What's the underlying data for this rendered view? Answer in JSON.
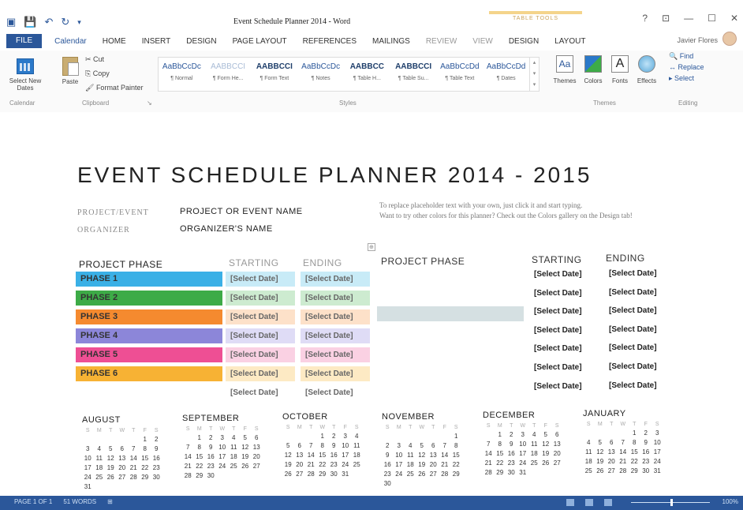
{
  "window": {
    "title": "Event Schedule Planner 2014 - Word",
    "context_tab_group": "TABLE TOOLS",
    "controls": [
      "?",
      "⊡",
      "—",
      "☐",
      "✕"
    ],
    "user": "Javier Flores"
  },
  "tabs": [
    "FILE",
    "Calendar",
    "HOME",
    "INSERT",
    "DESIGN",
    "PAGE LAYOUT",
    "REFERENCES",
    "MAILINGS",
    "REVIEW",
    "VIEW",
    "DESIGN",
    "LAYOUT"
  ],
  "ribbon": {
    "calendar_group": {
      "button": "Select New Dates",
      "label": "Calendar"
    },
    "clipboard_group": {
      "paste": "Paste",
      "cut": "Cut",
      "copy": "Copy",
      "format_painter": "Format Painter",
      "label": "Clipboard"
    },
    "styles": [
      {
        "sample": "AaBbCcDc",
        "name": "¶ Normal"
      },
      {
        "sample": "AABBCCI",
        "name": "¶ Form He..."
      },
      {
        "sample": "AABBCCI",
        "name": "¶ Form Text"
      },
      {
        "sample": "AaBbCcDc",
        "name": "¶ Notes"
      },
      {
        "sample": "AABBCC",
        "name": "¶ Table H..."
      },
      {
        "sample": "AABBCCI",
        "name": "¶ Table Su..."
      },
      {
        "sample": "AaBbCcDd",
        "name": "¶ Table Text"
      },
      {
        "sample": "AaBbCcDd",
        "name": "¶ Dates"
      }
    ],
    "styles_label": "Styles",
    "themes": [
      "Themes",
      "Colors",
      "Fonts",
      "Effects"
    ],
    "themes_label": "Themes",
    "editing": [
      "Find",
      "Replace",
      "Select"
    ],
    "editing_label": "Editing"
  },
  "document": {
    "title": "EVENT SCHEDULE PLANNER 2014 - 2015",
    "project_label": "PROJECT/EVENT",
    "project_value": "PROJECT OR EVENT NAME",
    "organizer_label": "ORGANIZER",
    "organizer_value": "ORGANIZER'S NAME",
    "tip_line1": "To replace placeholder text with your own, just click it and start typing.",
    "tip_line2": "Want to try other colors for this planner? Check out the Colors gallery on the Design tab!",
    "headers": {
      "phase": "PROJECT PHASE",
      "starting": "STARTING",
      "ending": "ENDING"
    },
    "phases": [
      {
        "name": "PHASE 1",
        "color": "#3ab0e6",
        "start": "[Select Date]",
        "end": "[Select Date]",
        "light": "#c8ebf7"
      },
      {
        "name": "PHASE 2",
        "color": "#3dab47",
        "start": "[Select Date]",
        "end": "[Select Date]",
        "light": "#cdebd0"
      },
      {
        "name": "PHASE 3",
        "color": "#f58a2f",
        "start": "[Select Date]",
        "end": "[Select Date]",
        "light": "#fde1c9"
      },
      {
        "name": "PHASE 4",
        "color": "#8c86d9",
        "start": "[Select Date]",
        "end": "[Select Date]",
        "light": "#dfdcf6"
      },
      {
        "name": "PHASE 5",
        "color": "#ee4f94",
        "start": "[Select Date]",
        "end": "[Select Date]",
        "light": "#fad1e3"
      },
      {
        "name": "PHASE 6",
        "color": "#f7b234",
        "start": "[Select Date]",
        "end": "[Select Date]",
        "light": "#fdeac4"
      }
    ],
    "extra_row": {
      "start": "[Select Date]",
      "end": "[Select Date]"
    },
    "right_dates": [
      {
        "start": "[Select Date]",
        "end": "[Select Date]"
      },
      {
        "start": "[Select Date]",
        "end": "[Select Date]"
      },
      {
        "start": "[Select Date]",
        "end": "[Select Date]"
      },
      {
        "start": "[Select Date]",
        "end": "[Select Date]"
      },
      {
        "start": "[Select Date]",
        "end": "[Select Date]"
      },
      {
        "start": "[Select Date]",
        "end": "[Select Date]"
      },
      {
        "start": "[Select Date]",
        "end": "[Select Date]"
      }
    ]
  },
  "calendars": [
    {
      "name": "AUGUST",
      "weeks": [
        [
          "",
          "",
          "",
          "",
          "",
          "1",
          "2"
        ],
        [
          "3",
          "4",
          "5",
          "6",
          "7",
          "8",
          "9"
        ],
        [
          "10",
          "11",
          "12",
          "13",
          "14",
          "15",
          "16"
        ],
        [
          "17",
          "18",
          "19",
          "20",
          "21",
          "22",
          "23"
        ],
        [
          "24",
          "25",
          "26",
          "27",
          "28",
          "29",
          "30"
        ],
        [
          "31",
          "",
          "",
          "",
          "",
          "",
          ""
        ]
      ]
    },
    {
      "name": "SEPTEMBER",
      "weeks": [
        [
          "",
          "1",
          "2",
          "3",
          "4",
          "5",
          "6"
        ],
        [
          "7",
          "8",
          "9",
          "10",
          "11",
          "12",
          "13"
        ],
        [
          "14",
          "15",
          "16",
          "17",
          "18",
          "19",
          "20"
        ],
        [
          "21",
          "22",
          "23",
          "24",
          "25",
          "26",
          "27"
        ],
        [
          "28",
          "29",
          "30",
          "",
          "",
          "",
          ""
        ]
      ]
    },
    {
      "name": "OCTOBER",
      "weeks": [
        [
          "",
          "",
          "",
          "1",
          "2",
          "3",
          "4"
        ],
        [
          "5",
          "6",
          "7",
          "8",
          "9",
          "10",
          "11"
        ],
        [
          "12",
          "13",
          "14",
          "15",
          "16",
          "17",
          "18"
        ],
        [
          "19",
          "20",
          "21",
          "22",
          "23",
          "24",
          "25"
        ],
        [
          "26",
          "27",
          "28",
          "29",
          "30",
          "31",
          ""
        ]
      ]
    },
    {
      "name": "NOVEMBER",
      "weeks": [
        [
          "",
          "",
          "",
          "",
          "",
          "",
          "1"
        ],
        [
          "2",
          "3",
          "4",
          "5",
          "6",
          "7",
          "8"
        ],
        [
          "9",
          "10",
          "11",
          "12",
          "13",
          "14",
          "15"
        ],
        [
          "16",
          "17",
          "18",
          "19",
          "20",
          "21",
          "22"
        ],
        [
          "23",
          "24",
          "25",
          "26",
          "27",
          "28",
          "29"
        ],
        [
          "30",
          "",
          "",
          "",
          "",
          "",
          ""
        ]
      ]
    },
    {
      "name": "DECEMBER",
      "weeks": [
        [
          "",
          "1",
          "2",
          "3",
          "4",
          "5",
          "6"
        ],
        [
          "7",
          "8",
          "9",
          "10",
          "11",
          "12",
          "13"
        ],
        [
          "14",
          "15",
          "16",
          "17",
          "18",
          "19",
          "20"
        ],
        [
          "21",
          "22",
          "23",
          "24",
          "25",
          "26",
          "27"
        ],
        [
          "28",
          "29",
          "30",
          "31",
          "",
          "",
          ""
        ]
      ]
    },
    {
      "name": "JANUARY",
      "weeks": [
        [
          "",
          "",
          "",
          "",
          "1",
          "2",
          "3"
        ],
        [
          "4",
          "5",
          "6",
          "7",
          "8",
          "9",
          "10"
        ],
        [
          "11",
          "12",
          "13",
          "14",
          "15",
          "16",
          "17"
        ],
        [
          "18",
          "19",
          "20",
          "21",
          "22",
          "23",
          "24"
        ],
        [
          "25",
          "26",
          "27",
          "28",
          "29",
          "30",
          "31"
        ]
      ]
    }
  ],
  "dow": [
    "S",
    "M",
    "T",
    "W",
    "T",
    "F",
    "S"
  ],
  "status": {
    "page": "PAGE 1 OF 1",
    "words": "51 WORDS",
    "zoom": "100%"
  }
}
